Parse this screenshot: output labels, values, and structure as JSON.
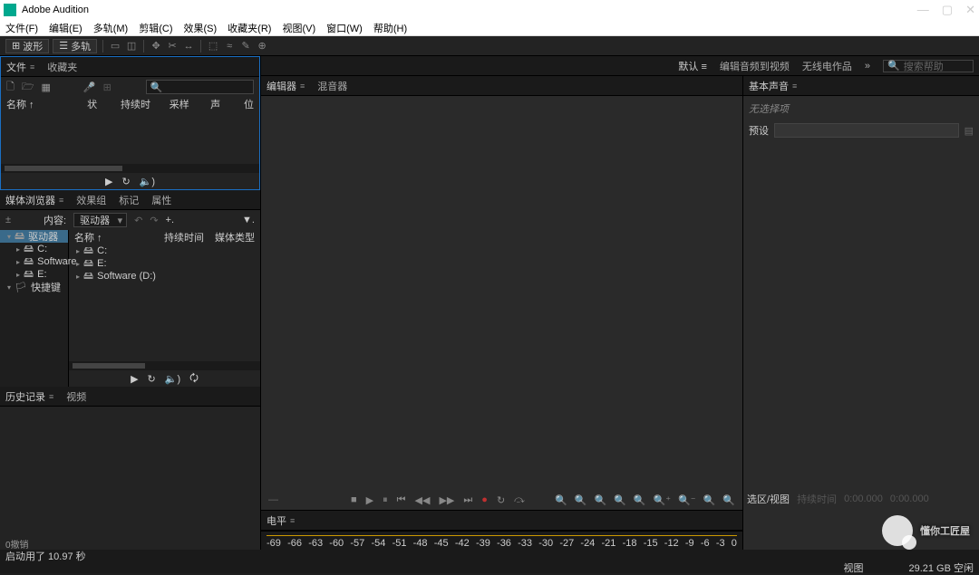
{
  "app": {
    "title": "Adobe Audition"
  },
  "win": {
    "min": "—",
    "max": "▢",
    "close": "✕"
  },
  "menu": [
    "文件(F)",
    "编辑(E)",
    "多轨(M)",
    "剪辑(C)",
    "效果(S)",
    "收藏夹(R)",
    "视图(V)",
    "窗口(W)",
    "帮助(H)"
  ],
  "toolbar": {
    "wave": "波形",
    "multi": "多轨"
  },
  "workspace": {
    "tabs": [
      "默认",
      "编辑音频到视频",
      "无线电作品"
    ],
    "more": "»",
    "search_icon": "🔍",
    "search_ph": "搜索帮助"
  },
  "files": {
    "tabs": [
      "文件",
      "收藏夹"
    ],
    "icons": {
      "new": "🗋",
      "open": "🗁",
      "grid": "▦",
      "rec": "●",
      "scissors": "✂"
    },
    "search_icon": "🔍",
    "cols": [
      "名称 ↑",
      "状态",
      "持续时间",
      "采样率",
      "声道",
      "位"
    ],
    "transport": {
      "play": "▶",
      "loop": "↻",
      "vol": "🔈)"
    }
  },
  "browser": {
    "tabs": [
      "媒体浏览器",
      "效果组",
      "标记",
      "属性"
    ],
    "content_label": "内容:",
    "dd": "驱动器",
    "back": "↶",
    "fwd": "↷",
    "plus": "+.",
    "filter": "▼.",
    "hdr": {
      "name": "名称 ↑",
      "dur": "持续时间",
      "type": "媒体类型"
    },
    "left": [
      {
        "label": "驱动器",
        "sel": true,
        "exp": true,
        "icon": "🖴"
      },
      {
        "label": "C:",
        "icon": "🖴"
      },
      {
        "label": "Software",
        "icon": "🖴"
      },
      {
        "label": "E:",
        "icon": "🖴"
      },
      {
        "label": "快捷键",
        "exp": true,
        "icon": "🏳"
      }
    ],
    "right": [
      {
        "label": "C:",
        "icon": "🖴"
      },
      {
        "label": "E:",
        "icon": "🖴"
      },
      {
        "label": "Software (D:)",
        "icon": "🖴"
      }
    ],
    "transport": {
      "play": "▶",
      "loop": "↻",
      "vol": "🔈)",
      "auto": "🗘"
    }
  },
  "history": {
    "tabs": [
      "历史记录",
      "视频"
    ],
    "undo": "0撤销"
  },
  "editor": {
    "tabs": [
      "编辑器",
      "混音器"
    ],
    "transport": {
      "stop": "■",
      "play": "▶",
      "pause": "⏸",
      "begin": "⏮",
      "rew": "◀◀",
      "ff": "▶▶",
      "end": "⏭",
      "rec": "●",
      "loop": "↻",
      "skip": "⤼"
    },
    "zoom": [
      "🔍",
      "🔍",
      "🔍",
      "🔍",
      "🔍",
      "🔍⁺",
      "🔍⁻",
      "🔍",
      "🔍"
    ]
  },
  "levels": {
    "title": "电平",
    "ticks": [
      "-69",
      "-66",
      "-63",
      "-60",
      "-57",
      "-54",
      "-51",
      "-48",
      "-45",
      "-42",
      "-39",
      "-36",
      "-33",
      "-30",
      "-27",
      "-24",
      "-21",
      "-18",
      "-15",
      "-12",
      "-9",
      "-6",
      "-3",
      "0"
    ]
  },
  "time": {
    "sel_label": "选区/视图",
    "t1": "0:00.000",
    "t2": "0:00.000"
  },
  "essential": {
    "tab": "基本声音",
    "nosel": "无选择项",
    "preset": "预设"
  },
  "status": {
    "launch": "启动用了 10.97 秒",
    "mem": "视图",
    "free": "29.21 GB 空闲",
    "dur": "持续时间"
  },
  "watermark": "懂你工匠屋"
}
